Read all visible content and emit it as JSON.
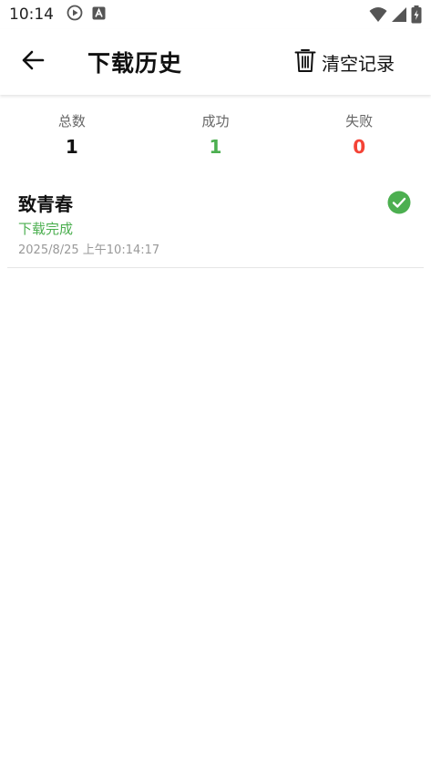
{
  "status_bar": {
    "time": "10:14",
    "left_icons": [
      "play-circle-icon",
      "a-box-icon"
    ],
    "right_icons": [
      "wifi-icon",
      "cellular-icon",
      "battery-icon"
    ]
  },
  "app_bar": {
    "back_icon": "arrow-left-icon",
    "title": "下载历史",
    "clear_icon": "trash-icon",
    "clear_label": "清空记录"
  },
  "stats": [
    {
      "label": "总数",
      "value": "1",
      "color": "#111111"
    },
    {
      "label": "成功",
      "value": "1",
      "color": "#4caf50"
    },
    {
      "label": "失败",
      "value": "0",
      "color": "#f44336"
    }
  ],
  "history": [
    {
      "title": "致青春",
      "status": "下载完成",
      "time": "2025/8/25 上午10:14:17",
      "status_icon": "check-circle-icon",
      "status_color": "#4caf50"
    }
  ]
}
